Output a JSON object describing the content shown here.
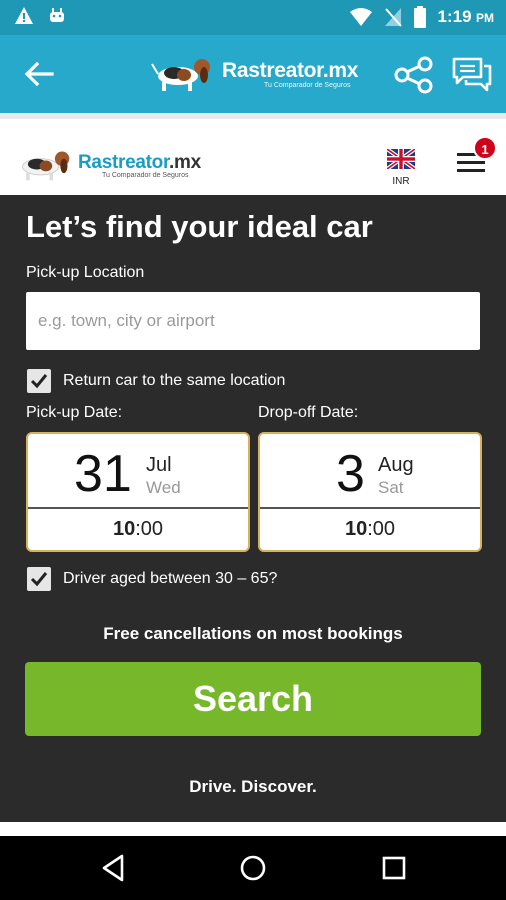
{
  "status_bar": {
    "time": "1:19",
    "ampm": "PM"
  },
  "app_bar": {
    "brand_name": "Rastreator.mx",
    "brand_tagline": "Tu Comparador de Seguros"
  },
  "site_header": {
    "brand_name": "Rastreator",
    "brand_suffix": ".mx",
    "brand_tagline": "Tu Comparador de Seguros",
    "currency": "INR",
    "menu_badge": "1"
  },
  "form": {
    "title": "Let’s find your ideal car",
    "pickup_location_label": "Pick-up Location",
    "pickup_location_placeholder": "e.g. town, city or airport",
    "return_same_label": "Return car to the same location",
    "pickup_date_label": "Pick-up Date:",
    "dropoff_date_label": "Drop-off Date:",
    "pickup": {
      "day": "31",
      "month": "Jul",
      "weekday": "Wed",
      "hour": "10",
      "minutes": ":00"
    },
    "dropoff": {
      "day": "3",
      "month": "Aug",
      "weekday": "Sat",
      "hour": "10",
      "minutes": ":00"
    },
    "driver_age_label": "Driver aged between 30 – 65?",
    "free_cancellations": "Free cancellations on most bookings",
    "search_label": "Search",
    "tagline": "Drive. Discover."
  },
  "colors": {
    "app_bar": "#27a9cc",
    "status_bar": "#1e98b5",
    "panel": "#2b2b2b",
    "search": "#76b82a",
    "date_border": "#d9b15a",
    "badge": "#d0021b"
  }
}
